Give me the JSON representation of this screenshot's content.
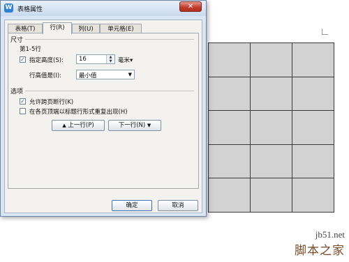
{
  "dialog": {
    "title": "表格属性",
    "app_icon": "W",
    "close_glyph": "✕"
  },
  "tabs": [
    {
      "label": "表格(T)",
      "active": false
    },
    {
      "label": "行(R)",
      "active": true
    },
    {
      "label": "列(U)",
      "active": false
    },
    {
      "label": "单元格(E)",
      "active": false
    }
  ],
  "size": {
    "section_title": "尺寸",
    "rows_label": "第1-5行",
    "specify_height_label": "指定高度(S):",
    "specify_height_checked": true,
    "height_value": "16",
    "unit": "毫米▾",
    "row_height_is_label": "行高值是(I):",
    "row_height_is_value": "最小值"
  },
  "options": {
    "section_title": "选项",
    "allow_break_label": "允许跨页断行(K)",
    "allow_break_checked": true,
    "repeat_header_label": "在各页顶端以标题行形式重复出现(H)",
    "repeat_header_checked": false
  },
  "nav": {
    "prev_label": "上一行(P)",
    "prev_icon": "▲",
    "next_label": "下一行(N)",
    "next_icon": "▼"
  },
  "footer": {
    "ok_label": "确定",
    "cancel_label": "取消"
  },
  "watermark": {
    "site": "jb51.net",
    "brand": "脚本之家"
  },
  "colors": {
    "dialog_frame": "#d9e6f4",
    "client_bg": "#f3f2ee",
    "close_button": "#c0392b",
    "table_cell": "#d2d2d2"
  }
}
